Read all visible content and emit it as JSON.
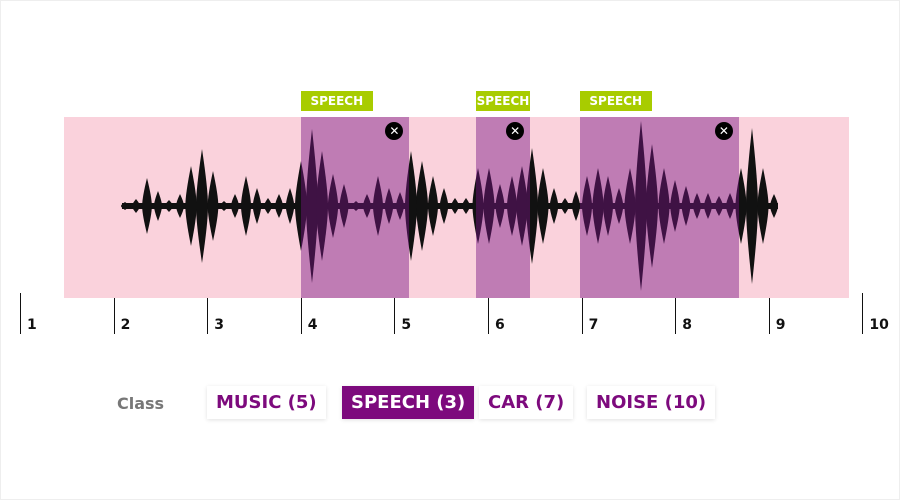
{
  "timeline": {
    "ticks": [
      "1",
      "2",
      "3",
      "4",
      "5",
      "6",
      "7",
      "8",
      "9",
      "10"
    ],
    "axis_range": [
      1,
      10
    ]
  },
  "regions": [
    {
      "label": "SPEECH",
      "start": 4.0,
      "end": 5.16
    },
    {
      "label": "SPEECH",
      "start": 5.87,
      "end": 6.45
    },
    {
      "label": "SPEECH",
      "start": 6.98,
      "end": 8.68
    }
  ],
  "classes": {
    "label": "Class",
    "items": [
      {
        "label": "MUSIC (5)",
        "active": false
      },
      {
        "label": "SPEECH (3)",
        "active": true
      },
      {
        "label": "CAR (7)",
        "active": false
      },
      {
        "label": "NOISE (10)",
        "active": false
      }
    ]
  },
  "icons": {
    "remove_region": "close-icon"
  },
  "colors": {
    "background_band": "#fad2dc",
    "region": "#b87bb5",
    "region_label": "#a8cc00",
    "accent": "#7d0a7d",
    "waveform": "#111111"
  }
}
